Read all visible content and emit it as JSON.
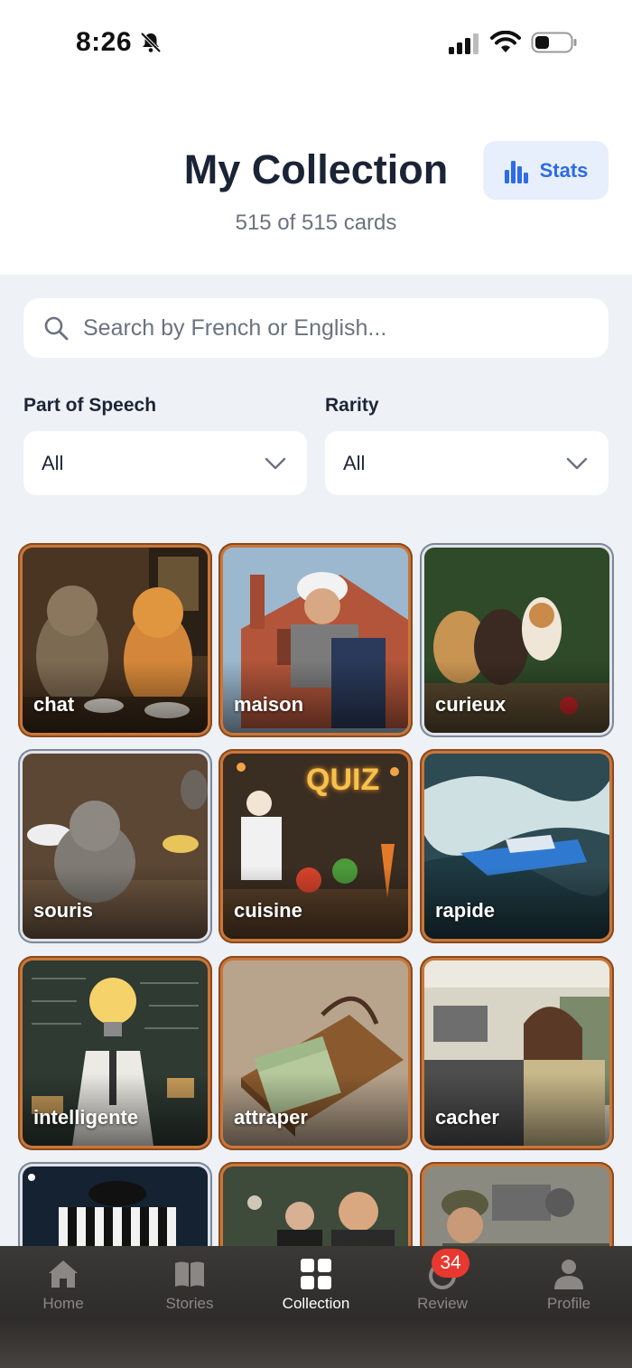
{
  "status_bar": {
    "time": "8:26",
    "icons": [
      "bell-off-icon",
      "signal-icon",
      "wifi-icon",
      "battery-icon"
    ]
  },
  "header": {
    "title": "My Collection",
    "subtitle": "515 of 515 cards",
    "stats_button": {
      "label": "Stats",
      "icon": "bar-chart-icon",
      "color": "#2e6be6",
      "background": "#e7effd"
    }
  },
  "search": {
    "placeholder": "Search by French or English...",
    "value": ""
  },
  "filters": {
    "part_of_speech": {
      "label": "Part of Speech",
      "selected": "All"
    },
    "rarity": {
      "label": "Rarity",
      "selected": "All"
    }
  },
  "cards": [
    {
      "word": "chat",
      "rarity_frame": "bronze"
    },
    {
      "word": "maison",
      "rarity_frame": "bronze"
    },
    {
      "word": "curieux",
      "rarity_frame": "silver"
    },
    {
      "word": "souris",
      "rarity_frame": "silver"
    },
    {
      "word": "cuisine",
      "rarity_frame": "bronze",
      "art_text": "QUIZ"
    },
    {
      "word": "rapide",
      "rarity_frame": "bronze"
    },
    {
      "word": "intelligente",
      "rarity_frame": "bronze"
    },
    {
      "word": "attraper",
      "rarity_frame": "bronze"
    },
    {
      "word": "cacher",
      "rarity_frame": "bronze"
    },
    {
      "word": "",
      "rarity_frame": "silver"
    },
    {
      "word": "",
      "rarity_frame": "bronze"
    },
    {
      "word": "",
      "rarity_frame": "bronze"
    }
  ],
  "nav": {
    "tabs": [
      {
        "label": "Home",
        "icon": "home-icon",
        "active": false
      },
      {
        "label": "Stories",
        "icon": "book-icon",
        "active": false
      },
      {
        "label": "Collection",
        "icon": "grid-icon",
        "active": true
      },
      {
        "label": "Review",
        "icon": "review-icon",
        "active": false,
        "badge": "34"
      },
      {
        "label": "Profile",
        "icon": "person-icon",
        "active": false
      }
    ]
  },
  "colors": {
    "accent": "#2e6be6",
    "badge": "#e8382f",
    "bronze_frame": "#c9763a",
    "silver_frame": "#dfe3ea"
  }
}
